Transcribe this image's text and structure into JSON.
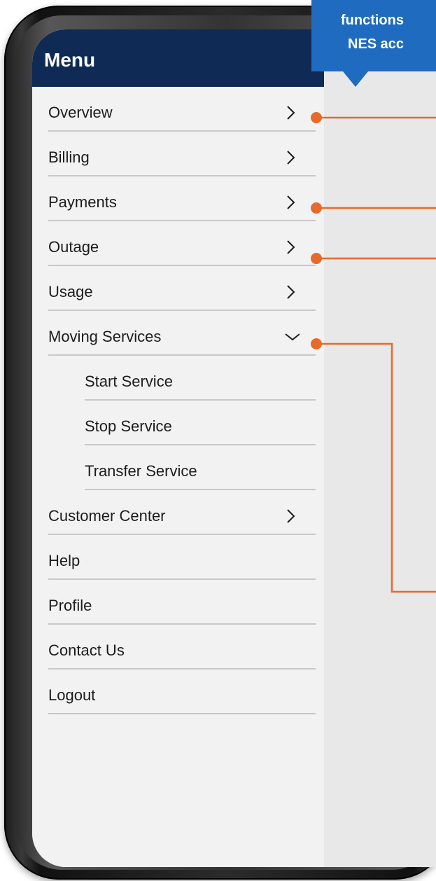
{
  "menu": {
    "title": "Menu",
    "items": [
      {
        "label": "Overview",
        "chevron": "right"
      },
      {
        "label": "Billing",
        "chevron": "right"
      },
      {
        "label": "Payments",
        "chevron": "right"
      },
      {
        "label": "Outage",
        "chevron": "right"
      },
      {
        "label": "Usage",
        "chevron": "right"
      },
      {
        "label": "Moving Services",
        "chevron": "down"
      },
      {
        "label": "Start Service",
        "chevron": "none",
        "sub": true
      },
      {
        "label": "Stop Service",
        "chevron": "none",
        "sub": true
      },
      {
        "label": "Transfer Service",
        "chevron": "none",
        "sub": true
      },
      {
        "label": "Customer Center",
        "chevron": "right"
      },
      {
        "label": "Help",
        "chevron": "none"
      },
      {
        "label": "Profile",
        "chevron": "none"
      },
      {
        "label": "Contact Us",
        "chevron": "none"
      },
      {
        "label": "Logout",
        "chevron": "none"
      }
    ]
  },
  "callout": {
    "line1": "functions",
    "line2": "NES acc"
  },
  "colors": {
    "header_bg": "#102a56",
    "callout_bg": "#1f6bbf",
    "connector": "#e8692a"
  }
}
